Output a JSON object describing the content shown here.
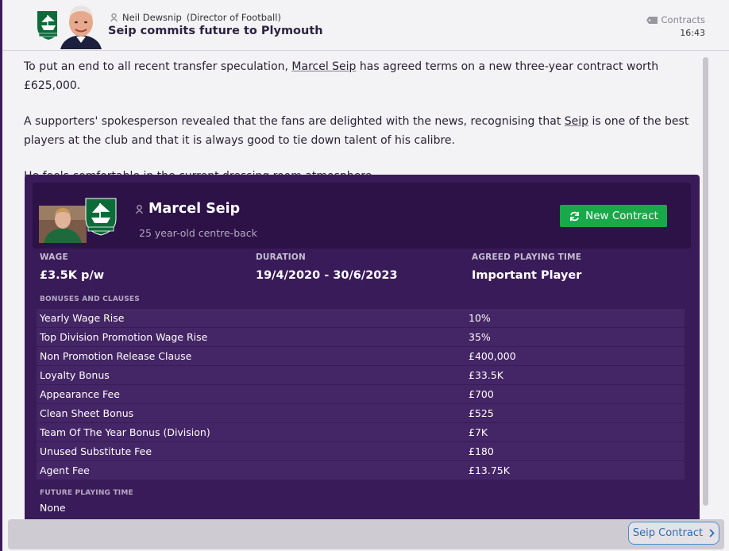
{
  "header": {
    "sender_name": "Neil Dewsnip",
    "sender_role": "(Director of Football)",
    "headline": "Seip commits future to Plymouth",
    "category": "Contracts",
    "time": "16:43"
  },
  "article": {
    "p1_pre": "To put an end to all recent transfer speculation, ",
    "p1_link": "Marcel Seip",
    "p1_post": " has agreed terms on a new three-year contract worth £625,000.",
    "p2_pre": "A supporters' spokesperson revealed that the fans are delighted with the news, recognising that ",
    "p2_link": "Seip",
    "p2_post": " is one of the best players at the club and that it is always good to tie down talent of his calibre.",
    "p3": "He feels comfortable in the current dressing room atmosphere."
  },
  "contract": {
    "player_name": "Marcel Seip",
    "player_desc": "25 year-old centre-back",
    "new_contract_label": "New Contract",
    "wage_label": "WAGE",
    "wage_value": "£3.5K p/w",
    "duration_label": "DURATION",
    "duration_value": "19/4/2020 - 30/6/2023",
    "playing_time_label": "AGREED PLAYING TIME",
    "playing_time_value": "Important Player",
    "bonuses_label": "BONUSES AND CLAUSES",
    "bonuses": [
      {
        "name": "Yearly Wage Rise",
        "value": "10%"
      },
      {
        "name": "Top Division Promotion Wage Rise",
        "value": "35%"
      },
      {
        "name": "Non Promotion Release Clause",
        "value": "£400,000"
      },
      {
        "name": "Loyalty Bonus",
        "value": "£33.5K"
      },
      {
        "name": "Appearance Fee",
        "value": "£700"
      },
      {
        "name": "Clean Sheet Bonus",
        "value": "£525"
      },
      {
        "name": "Team Of The Year Bonus (Division)",
        "value": "£7K"
      },
      {
        "name": "Unused Substitute Fee",
        "value": "£180"
      },
      {
        "name": "Agent Fee",
        "value": "£13.75K"
      }
    ],
    "future_label": "FUTURE PLAYING TIME",
    "future_value": "None"
  },
  "footer": {
    "link_label": "Seip Contract"
  },
  "colors": {
    "panel": "#3a1b59",
    "card": "#2c1246",
    "row": "#442565",
    "green_button": "#19a84a",
    "link_blue": "#2d6db3"
  },
  "icons": [
    "plymouth-crest-icon",
    "person-icon",
    "contracts-tag-icon",
    "refresh-icon",
    "chevron-right-icon"
  ]
}
